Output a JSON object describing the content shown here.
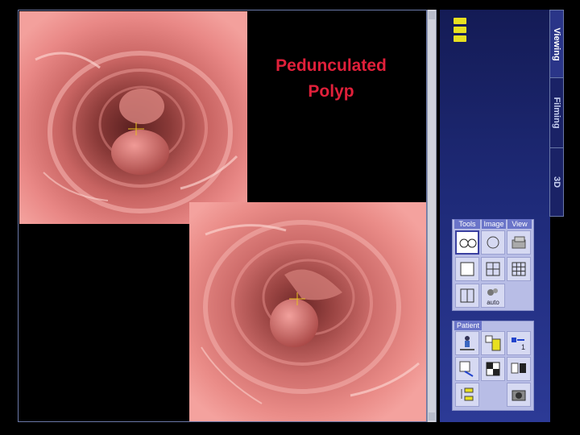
{
  "annotation": {
    "line1": "Pedunculated",
    "line2": "Polyp"
  },
  "side_tabs": [
    {
      "label": "Viewing",
      "active": true
    },
    {
      "label": "Filming",
      "active": false
    },
    {
      "label": "3D",
      "active": false
    }
  ],
  "tool_box": {
    "tabs": [
      {
        "label": "Tools"
      },
      {
        "label": "Image"
      },
      {
        "label": "View"
      }
    ],
    "buttons": [
      {
        "icon": "dual-fly-view-icon",
        "selected": true
      },
      {
        "icon": "face-view-icon"
      },
      {
        "icon": "volume-stack-icon"
      },
      {
        "icon": "layout-1x1-icon"
      },
      {
        "icon": "layout-2x2-icon"
      },
      {
        "icon": "layout-3x3-icon"
      },
      {
        "icon": "layout-1x2-icon"
      },
      {
        "icon": "auto-layout-icon",
        "label": "auto"
      }
    ]
  },
  "patient_box": {
    "tab": "Patient"
  },
  "colors": {
    "tissue": "#e87a78",
    "panel": "#1e2a78",
    "annotation": "#e0203a",
    "folder": "#e8e020"
  }
}
